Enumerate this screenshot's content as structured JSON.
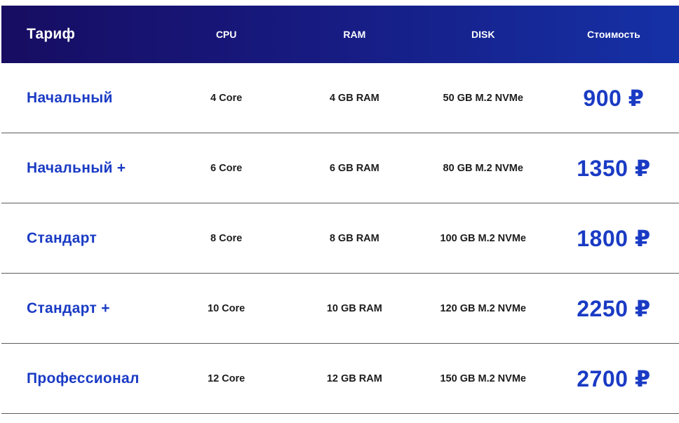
{
  "table": {
    "headers": {
      "plan": "Тариф",
      "cpu": "CPU",
      "ram": "RAM",
      "disk": "DISK",
      "price": "Стоимость"
    },
    "rows": [
      {
        "plan": "Начальный",
        "cpu": "4 Core",
        "ram": "4 GB RAM",
        "disk": "50 GB M.2 NVMe",
        "price": "900 ₽"
      },
      {
        "plan": "Начальный +",
        "cpu": "6 Core",
        "ram": "6 GB RAM",
        "disk": "80 GB M.2 NVMe",
        "price": "1350 ₽"
      },
      {
        "plan": "Стандарт",
        "cpu": "8 Core",
        "ram": "8 GB RAM",
        "disk": "100 GB M.2 NVMe",
        "price": "1800 ₽"
      },
      {
        "plan": "Стандарт +",
        "cpu": "10 Core",
        "ram": "10 GB RAM",
        "disk": "120 GB M.2 NVMe",
        "price": "2250 ₽"
      },
      {
        "plan": "Профессионал",
        "cpu": "12 Core",
        "ram": "12 GB RAM",
        "disk": "150 GB M.2 NVMe",
        "price": "2700 ₽"
      }
    ]
  },
  "colors": {
    "header_gradient_start": "#170d62",
    "header_gradient_end": "#1531a6",
    "accent_blue": "#1a3bc4",
    "spec_text": "#1c1c1c",
    "divider": "#5c5c5c"
  }
}
